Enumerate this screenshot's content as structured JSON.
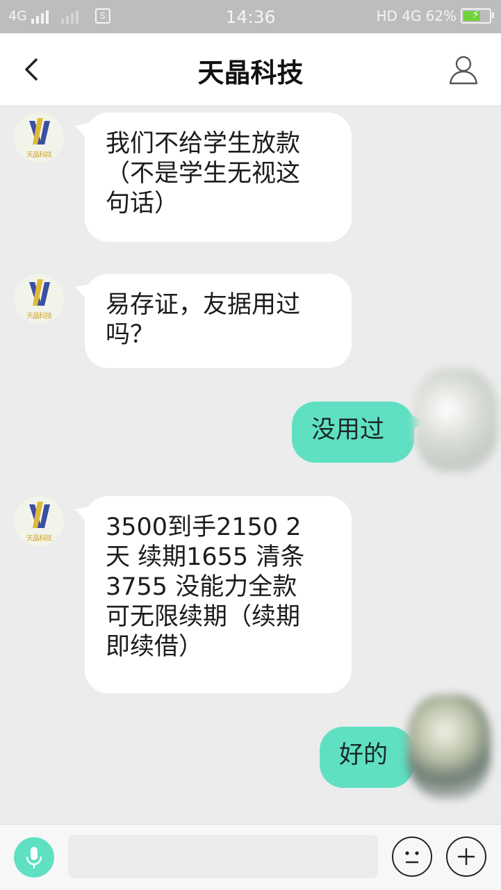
{
  "status_bar": {
    "carrier_left": "4G",
    "time": "14:36",
    "network_right": "HD 4G",
    "battery": "62%",
    "sim_icon": "S"
  },
  "header": {
    "title": "天晶科技",
    "back_icon": "chevron-left-icon",
    "profile_icon": "person-icon"
  },
  "contact_avatar_text": "天晶科技",
  "messages": [
    {
      "side": "left",
      "text": "我们不给学生放款\n（不是学生无视这\n句话）"
    },
    {
      "side": "left",
      "text": "易存证，友据用过\n吗？"
    },
    {
      "side": "right",
      "text": "没用过"
    },
    {
      "side": "left",
      "text": "3500到手2150 2\n天 续期1655 清条\n3755 没能力全款\n可无限续期（续期\n即续借）"
    },
    {
      "side": "right",
      "text": "好的"
    }
  ],
  "input_bar": {
    "input_value": "",
    "mic_icon": "microphone-icon",
    "emoji_icon": "emoji-icon",
    "plus_icon": "plus-icon"
  },
  "colors": {
    "accent": "#5fe0c3",
    "status_bar_bg": "#bdbdbd",
    "chat_bg": "#ececec",
    "bubble_left": "#ffffff",
    "logo_blue": "#3b4fa3",
    "logo_yellow": "#e0b93a"
  }
}
